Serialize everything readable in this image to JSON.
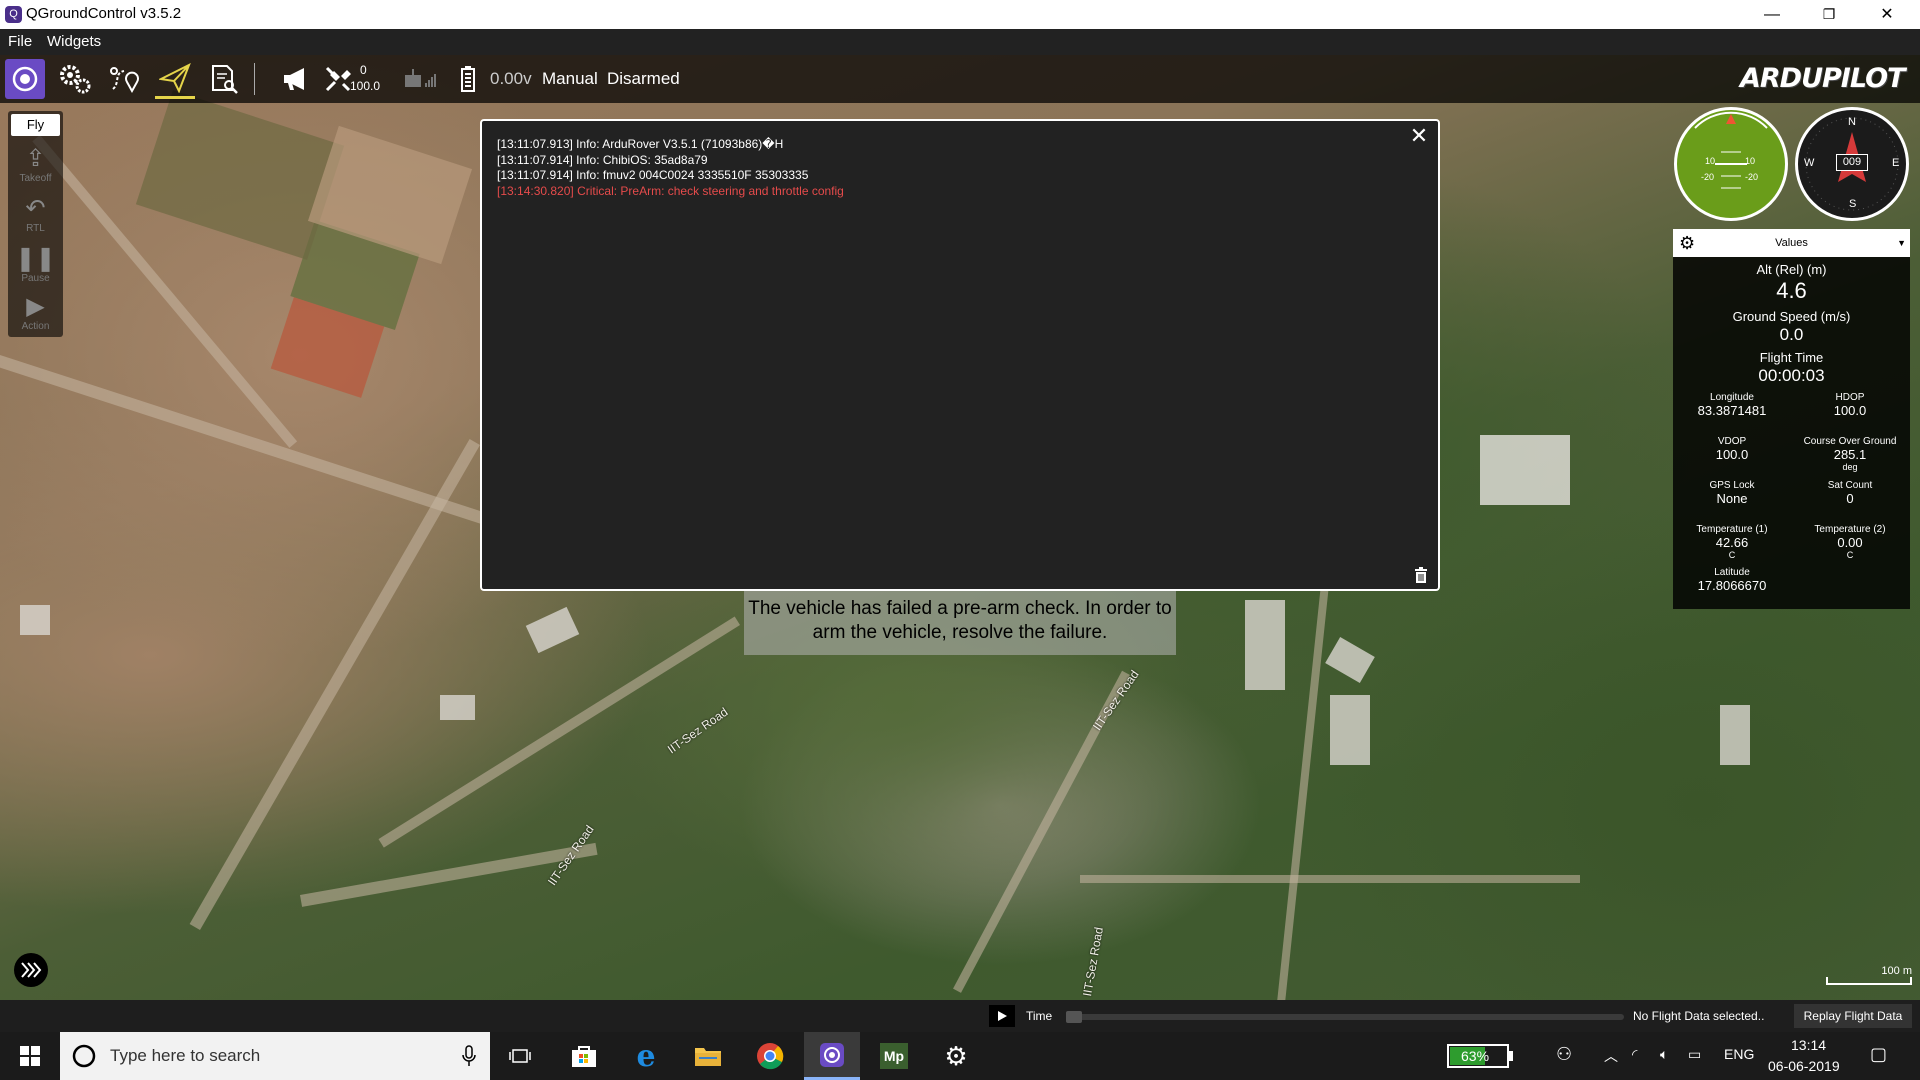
{
  "titlebar": {
    "title": "QGroundControl v3.5.2",
    "minimize": "—",
    "restore": "❐",
    "close": "✕"
  },
  "menubar": {
    "items": [
      "File",
      "Widgets"
    ]
  },
  "toolbar": {
    "sat_count": "0",
    "hdop": "100.0",
    "battery_voltage": "0.00v",
    "flight_mode": "Manual",
    "arm_status": "Disarmed",
    "logo_text": "ARDUPILOT"
  },
  "fly_strip": {
    "header": "Fly",
    "items": [
      {
        "label": "Takeoff",
        "icon": "takeoff-icon"
      },
      {
        "label": "RTL",
        "icon": "rtl-icon"
      },
      {
        "label": "Pause",
        "icon": "pause-icon"
      },
      {
        "label": "Action",
        "icon": "action-icon"
      }
    ]
  },
  "messages": [
    {
      "text": "[13:11:07.913] Info: ArduRover V3.5.1 (71093b86)�H",
      "level": "info"
    },
    {
      "text": "[13:11:07.914] Info: ChibiOS: 35ad8a79",
      "level": "info"
    },
    {
      "text": "[13:11:07.914] Info: fmuv2 004C0024 3335510F 35303335",
      "level": "info"
    },
    {
      "text": "[13:14:30.820] Critical: PreArm: check steering and throttle config",
      "level": "critical"
    }
  ],
  "prearm_notice": "The vehicle has failed a pre-arm check. In order to arm the vehicle, resolve the failure.",
  "attitude": {
    "pitch_labels": [
      "10",
      "10",
      "-20",
      "-20"
    ]
  },
  "compass": {
    "heading": "009",
    "n": "N",
    "s": "S",
    "e": "E",
    "w": "W"
  },
  "values_panel": {
    "header": "Values",
    "alt_label": "Alt (Rel) (m)",
    "alt_value": "4.6",
    "gs_label": "Ground Speed (m/s)",
    "gs_value": "0.0",
    "ft_label": "Flight Time",
    "ft_value": "00:00:03",
    "cells": [
      {
        "label": "Longitude",
        "value": "83.3871481",
        "unit": ""
      },
      {
        "label": "HDOP",
        "value": "100.0",
        "unit": ""
      },
      {
        "label": "VDOP",
        "value": "100.0",
        "unit": ""
      },
      {
        "label": "Course Over Ground",
        "value": "285.1",
        "unit": "deg"
      },
      {
        "label": "GPS Lock",
        "value": "None",
        "unit": ""
      },
      {
        "label": "Sat Count",
        "value": "0",
        "unit": ""
      },
      {
        "label": "Temperature (1)",
        "value": "42.66",
        "unit": "C"
      },
      {
        "label": "Temperature (2)",
        "value": "0.00",
        "unit": "C"
      },
      {
        "label": "Latitude",
        "value": "17.8066670",
        "unit": ""
      }
    ]
  },
  "map": {
    "scale_label": "100 m",
    "road_labels": [
      "IIT-Sez Road",
      "IIT-Sez Road",
      "IIT-Sez Road",
      "IIT-Sez Road"
    ]
  },
  "replay": {
    "time_label": "Time",
    "status": "No Flight Data selected..",
    "button": "Replay Flight Data"
  },
  "taskbar": {
    "search_placeholder": "Type here to search",
    "battery": "63%",
    "lang": "ENG",
    "time": "13:14",
    "date": "06-06-2019"
  }
}
